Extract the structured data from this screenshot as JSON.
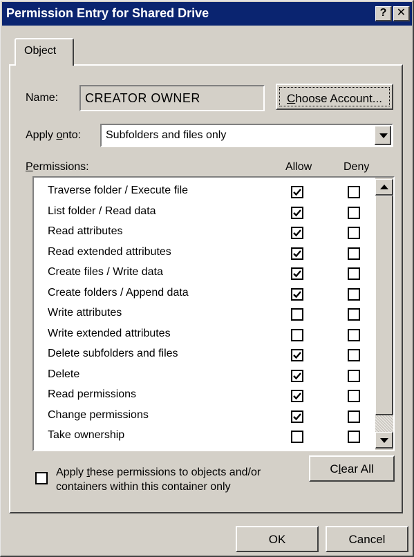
{
  "window": {
    "title": "Permission Entry for Shared Drive",
    "help_label": "?",
    "close_label": "✕",
    "colors": {
      "titlebar": "#0a2470",
      "face": "#d4d0c8"
    }
  },
  "tab": {
    "label": "Object"
  },
  "name": {
    "label": "Name:",
    "value": "CREATOR OWNER"
  },
  "choose_account": {
    "label_pre": "",
    "label_key": "C",
    "label_post": "hoose Account..."
  },
  "apply_onto": {
    "label_pre": "Apply ",
    "label_key": "o",
    "label_post": "nto:",
    "value": "Subfolders and files only"
  },
  "permissions": {
    "label_key": "P",
    "label_post": "ermissions:",
    "allow_header": "Allow",
    "deny_header": "Deny",
    "items": [
      {
        "name": "Traverse folder / Execute file",
        "allow": true,
        "deny": false
      },
      {
        "name": "List folder / Read data",
        "allow": true,
        "deny": false
      },
      {
        "name": "Read attributes",
        "allow": true,
        "deny": false
      },
      {
        "name": "Read extended attributes",
        "allow": true,
        "deny": false
      },
      {
        "name": "Create files / Write data",
        "allow": true,
        "deny": false
      },
      {
        "name": "Create folders / Append data",
        "allow": true,
        "deny": false
      },
      {
        "name": "Write attributes",
        "allow": false,
        "deny": false
      },
      {
        "name": "Write extended attributes",
        "allow": false,
        "deny": false
      },
      {
        "name": "Delete subfolders and files",
        "allow": true,
        "deny": false
      },
      {
        "name": "Delete",
        "allow": true,
        "deny": false
      },
      {
        "name": "Read permissions",
        "allow": true,
        "deny": false
      },
      {
        "name": "Change permissions",
        "allow": true,
        "deny": false
      },
      {
        "name": "Take ownership",
        "allow": false,
        "deny": false
      }
    ]
  },
  "apply_within": {
    "checked": false,
    "line1_pre": "Apply ",
    "line1_key": "t",
    "line1_post": "hese permissions to objects and/or",
    "line2": "containers within this container only"
  },
  "clear_all": {
    "label_pre": "C",
    "label_key": "l",
    "label_post": "ear All"
  },
  "ok": {
    "label": "OK"
  },
  "cancel": {
    "label": "Cancel"
  }
}
